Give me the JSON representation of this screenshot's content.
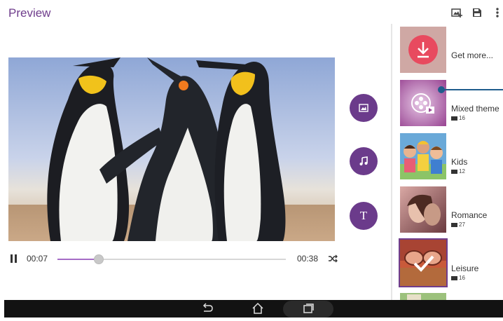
{
  "window": {
    "title": "Preview"
  },
  "toolbar": {
    "icons": [
      "add-to-album-icon",
      "save-icon",
      "more-vert-icon"
    ]
  },
  "player": {
    "current_time": "00:07",
    "total_time": "00:38",
    "progress": 0.18
  },
  "fabs": [
    {
      "icon": "image-icon"
    },
    {
      "icon": "music-note-icon"
    },
    {
      "icon": "text-icon",
      "label": "T"
    }
  ],
  "themes": [
    {
      "name": "Get more...",
      "count": "",
      "icon": "download-icon"
    },
    {
      "name": "Mixed theme",
      "count": "16",
      "icon": "film-icon"
    },
    {
      "name": "Kids",
      "count": "12"
    },
    {
      "name": "Romance",
      "count": "27"
    },
    {
      "name": "Leisure",
      "count": "16",
      "selected": true
    }
  ],
  "colors": {
    "accent": "#6f3d8c",
    "progress": "#a56cc6",
    "nav_bar": "#121212",
    "download_badge": "#e84a5f",
    "indicator": "#1f5c8c"
  },
  "navbar": {
    "icons": [
      "back-icon",
      "home-icon",
      "recent-apps-icon"
    ]
  }
}
